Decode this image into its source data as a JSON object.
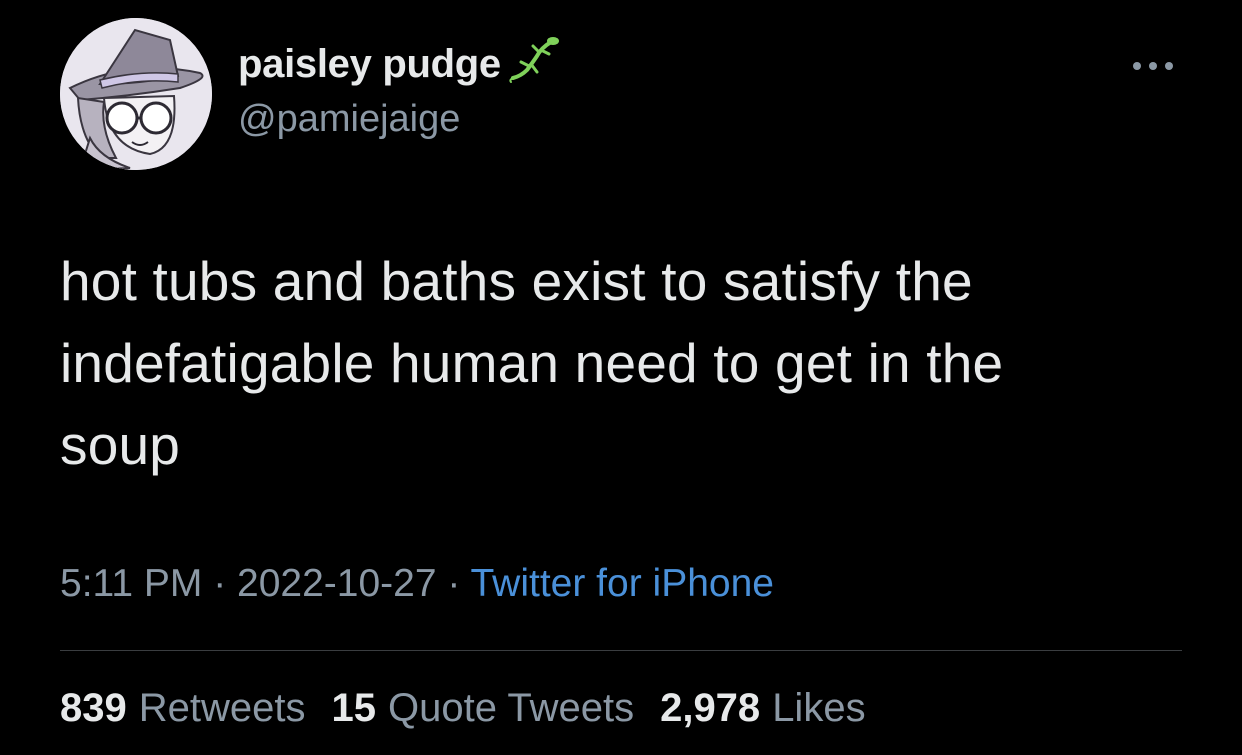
{
  "author": {
    "display_name": "paisley pudge",
    "handle": "@pamiejaige",
    "avatar_icon": "witch-avatar-icon",
    "badge_icon": "lizard-icon"
  },
  "tweet": {
    "text": "hot tubs and baths exist to satisfy the\nindefatigable human need to get in the\nsoup"
  },
  "meta": {
    "time": "5:11 PM",
    "separator": " · ",
    "date": "2022-10-27",
    "source": "Twitter for iPhone"
  },
  "stats": {
    "retweets_count": "839",
    "retweets_label": "Retweets",
    "quotes_count": "15",
    "quotes_label": "Quote Tweets",
    "likes_count": "2,978",
    "likes_label": "Likes"
  },
  "colors": {
    "background": "#000000",
    "primary_text": "#e7e9ea",
    "secondary_text": "#8b98a5",
    "link": "#4a90d9",
    "badge": "#7fd15a"
  },
  "more_icon": "more-horizontal-icon"
}
